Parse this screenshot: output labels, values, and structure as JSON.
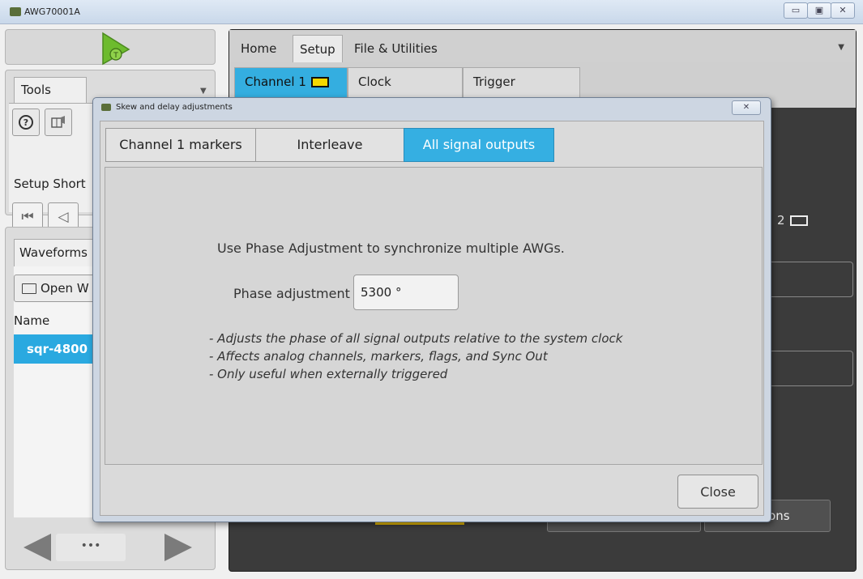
{
  "window": {
    "title": "AWG70001A",
    "minimize": "▭",
    "maximize": "▣",
    "close": "✕"
  },
  "tools": {
    "tab_label": "Tools",
    "help_icon": "?",
    "setup_shortcuts_label": "Setup Short",
    "nav_first": "⏮",
    "nav_prev": "◁"
  },
  "waveforms": {
    "tab_label": "Waveforms",
    "open_button": "Open W",
    "name_header": "Name",
    "rows": [
      "sqr-4800"
    ],
    "scroll_thumb": "•••"
  },
  "main": {
    "tabs": [
      "Home",
      "Setup",
      "File & Utilities"
    ],
    "active_tab": "Setup",
    "sub_tabs": [
      "Channel 1",
      "Clock",
      "Trigger"
    ],
    "channel2_label": "2",
    "options_button": "options"
  },
  "dialog": {
    "title": "Skew and delay adjustments",
    "tabs": [
      "Channel 1 markers",
      "Interleave",
      "All signal outputs"
    ],
    "active_tab": "All signal outputs",
    "intro": "Use Phase Adjustment to synchronize multiple AWGs.",
    "phase_label": "Phase adjustment",
    "phase_value": "5300 °",
    "notes": [
      "- Adjusts the phase of all signal outputs relative to the system clock",
      "- Affects analog channels, markers, flags, and Sync Out",
      "- Only useful when externally triggered"
    ],
    "close_button": "Close",
    "close_x": "✕"
  },
  "colors": {
    "accent": "#34aee0",
    "marker_yellow": "#f5d800",
    "dark_bg": "#3b3b3b"
  }
}
